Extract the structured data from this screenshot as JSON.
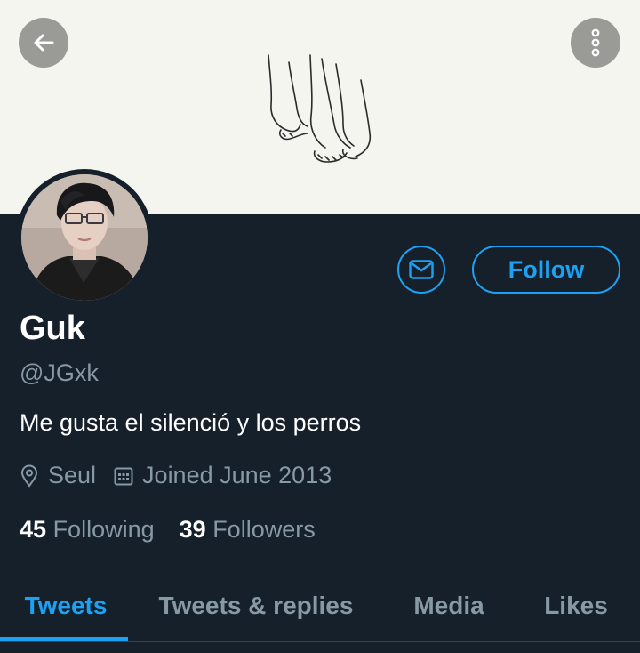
{
  "header": {
    "back_icon": "arrow-left-icon",
    "more_icon": "more-vertical-icon",
    "banner_background": "#f4f5ee"
  },
  "profile": {
    "name": "Guk",
    "handle": "@JGxk",
    "bio": "Me gusta el silenció y los perros",
    "location": "Seul",
    "joined": "Joined June 2013",
    "following_count": "45",
    "following_label": "Following",
    "followers_count": "39",
    "followers_label": "Followers"
  },
  "actions": {
    "message_icon": "mail-icon",
    "follow_label": "Follow"
  },
  "tabs": [
    {
      "label": "Tweets",
      "active": true
    },
    {
      "label": "Tweets & replies",
      "active": false
    },
    {
      "label": "Media",
      "active": false
    },
    {
      "label": "Likes",
      "active": false
    }
  ],
  "colors": {
    "background": "#15202b",
    "accent": "#1da1f2",
    "secondary_text": "#8899a6"
  }
}
